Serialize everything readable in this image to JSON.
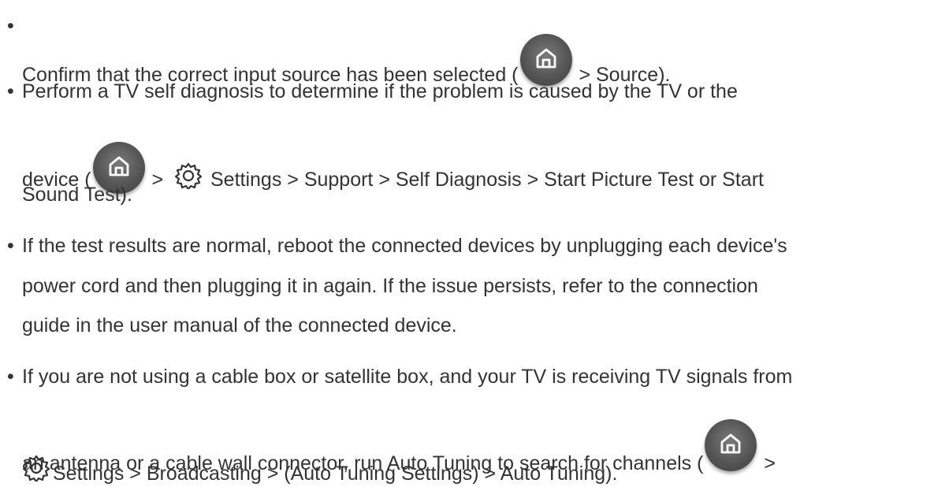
{
  "icons": {
    "home": "home-icon",
    "settings": "gear-icon"
  },
  "colors": {
    "text": "#333333",
    "button": "#555555"
  },
  "items": [
    {
      "lines": [
        [
          "Confirm that the correct input source has been selected (",
          "",
          " > Source)."
        ]
      ]
    },
    {
      "lines": [
        [
          "Perform a TV self diagnosis to determine if the problem is caused by the TV or the"
        ],
        [
          "device (",
          "",
          " > ",
          "",
          " Settings > Support > Self Diagnosis > Start Picture Test or Start"
        ],
        [
          "Sound Test)."
        ]
      ]
    },
    {
      "lines": [
        [
          "If the test results are normal, reboot the connected devices by unplugging each device's"
        ],
        [
          "power cord and then plugging it in again. If the issue persists, refer to the connection"
        ],
        [
          "guide in the user manual of the connected device."
        ]
      ]
    },
    {
      "lines": [
        [
          "If you are not using a cable box or satellite box, and your TV is receiving TV signals from"
        ],
        [
          "an antenna or a cable wall connector, run Auto Tuning to search for channels (",
          "",
          " >"
        ],
        [
          "",
          "Settings > Broadcasting > (Auto Tuning Settings) > Auto Tuning)."
        ]
      ]
    }
  ]
}
